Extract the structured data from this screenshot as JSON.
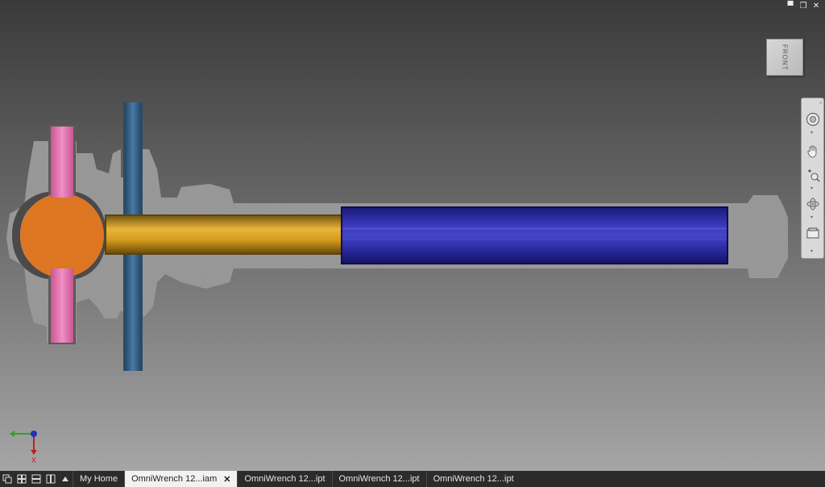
{
  "window_controls": {
    "minimize": "▀",
    "restore": "❐",
    "close": "✕"
  },
  "viewcube": {
    "face_label": "FRONT"
  },
  "nav_bar": {
    "close_glyph": "▫",
    "tools": [
      {
        "icon": "full-navigation-wheel-icon"
      },
      {
        "icon": "pan-hand-icon"
      },
      {
        "icon": "zoom-icon"
      },
      {
        "icon": "orbit-icon"
      },
      {
        "icon": "look-at-icon"
      }
    ]
  },
  "triad": {
    "x_label": "X"
  },
  "colors": {
    "pink_shaft": "#e77ab2",
    "blue_rod": "#3d6a93",
    "orange_ball": "#e47a22",
    "gold_rod": "#dca020",
    "blue_sleeve": "#2828a8",
    "housing": "#9c9c9c"
  },
  "tabbar": {
    "layout_icons": [
      "cascade-windows-icon",
      "tile-windows-icon",
      "tile-horizontal-icon",
      "tile-vertical-icon",
      "tab-list-up-icon"
    ],
    "tabs": [
      {
        "label": "My Home",
        "active": false
      },
      {
        "label": "OmniWrench 12...iam",
        "active": true
      },
      {
        "label": "OmniWrench 12...ipt",
        "active": false
      },
      {
        "label": "OmniWrench 12...ipt",
        "active": false
      },
      {
        "label": "OmniWrench 12...ipt",
        "active": false
      }
    ],
    "close_glyph": "✕"
  }
}
